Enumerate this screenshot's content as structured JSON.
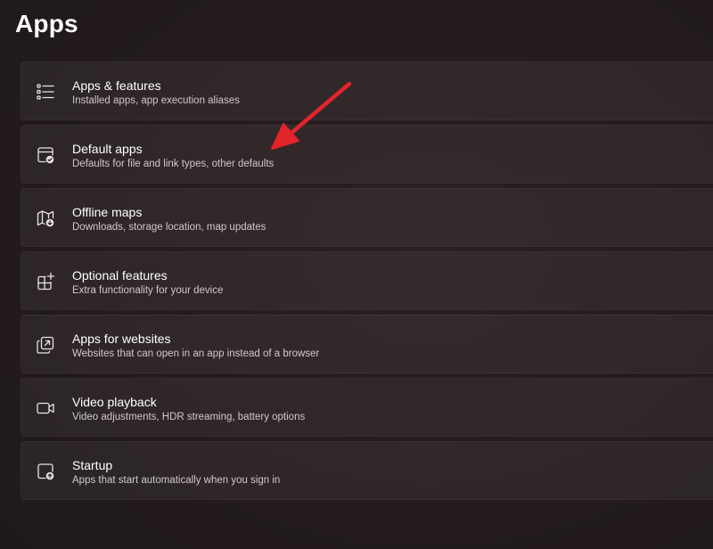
{
  "page": {
    "title": "Apps"
  },
  "items": [
    {
      "icon": "apps-list-icon",
      "title": "Apps & features",
      "subtitle": "Installed apps, app execution aliases"
    },
    {
      "icon": "default-apps-icon",
      "title": "Default apps",
      "subtitle": "Defaults for file and link types, other defaults"
    },
    {
      "icon": "offline-map-icon",
      "title": "Offline maps",
      "subtitle": "Downloads, storage location, map updates"
    },
    {
      "icon": "optional-features-icon",
      "title": "Optional features",
      "subtitle": "Extra functionality for your device"
    },
    {
      "icon": "apps-for-websites-icon",
      "title": "Apps for websites",
      "subtitle": "Websites that can open in an app instead of a browser"
    },
    {
      "icon": "video-camera-icon",
      "title": "Video playback",
      "subtitle": "Video adjustments, HDR streaming, battery options"
    },
    {
      "icon": "startup-icon",
      "title": "Startup",
      "subtitle": "Apps that start automatically when you sign in"
    }
  ],
  "annotation": {
    "arrow_color": "#e3242b"
  }
}
